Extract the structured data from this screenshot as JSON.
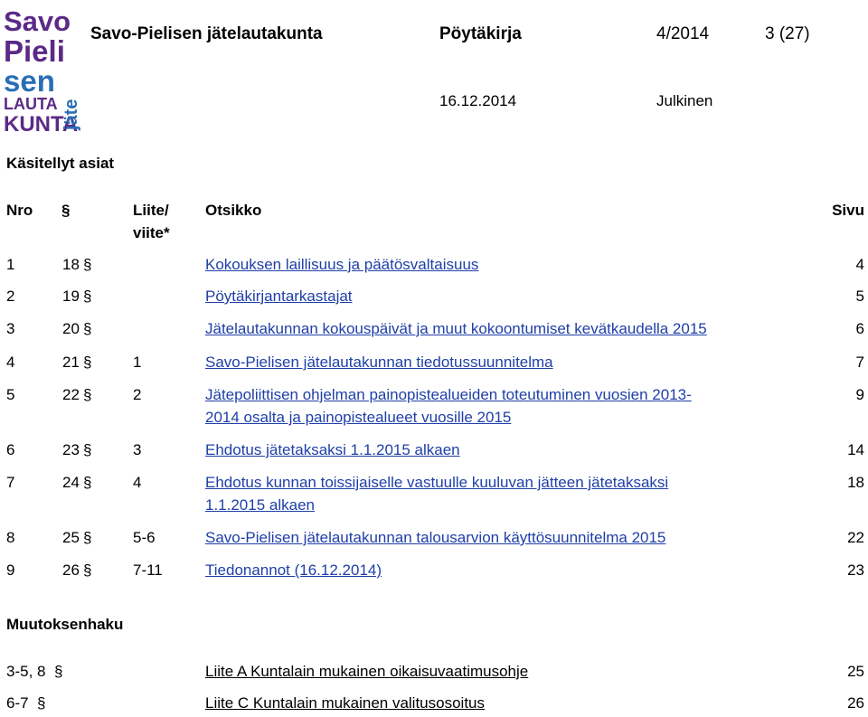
{
  "logo": {
    "lines": [
      "Savo",
      "Pieli",
      "sen",
      "LAUTA",
      "KUNTA"
    ],
    "side": "jäte",
    "colors": {
      "purple": "#5b2a86",
      "blue": "#2a6fb5"
    }
  },
  "header": {
    "org": "Savo-Pielisen jätelautakunta",
    "doc_type": "Pöytäkirja",
    "doc_no": "4/2014",
    "page": "3 (27)",
    "date": "16.12.2014",
    "status": "Julkinen"
  },
  "section1": "Käsitellyt asiat",
  "columns": {
    "nro": "Nro",
    "par_sign": "§",
    "liite": "Liite/\nviite*",
    "otsikko": "Otsikko",
    "sivu": "Sivu"
  },
  "items": [
    {
      "nro": "1",
      "par": "18",
      "liite": "",
      "title_lines": [
        "Kokouksen laillisuus ja päätösvaltaisuus"
      ],
      "sivu": "4"
    },
    {
      "nro": "2",
      "par": "19",
      "liite": "",
      "title_lines": [
        "Pöytäkirjantarkastajat"
      ],
      "sivu": "5"
    },
    {
      "nro": "3",
      "par": "20",
      "liite": "",
      "title_lines": [
        "Jätelautakunnan kokouspäivät ja muut kokoontumiset kevätkaudella 2015"
      ],
      "sivu": "6"
    },
    {
      "nro": "4",
      "par": "21",
      "liite": "1",
      "title_lines": [
        "Savo-Pielisen jätelautakunnan tiedotussuunnitelma"
      ],
      "sivu": "7"
    },
    {
      "nro": "5",
      "par": "22",
      "liite": "2",
      "title_lines": [
        "Jätepoliittisen ohjelman painopistealueiden toteutuminen vuosien 2013-",
        "2014 osalta ja painopistealueet vuosille 2015"
      ],
      "sivu": "9"
    },
    {
      "nro": "6",
      "par": "23",
      "liite": "3",
      "title_lines": [
        "Ehdotus jätetaksaksi 1.1.2015 alkaen"
      ],
      "sivu": "14"
    },
    {
      "nro": "7",
      "par": "24",
      "liite": "4",
      "title_lines": [
        "Ehdotus kunnan toissijaiselle vastuulle kuuluvan jätteen jätetaksaksi",
        "1.1.2015 alkaen"
      ],
      "sivu": "18"
    },
    {
      "nro": "8",
      "par": "25",
      "liite": "5-6",
      "title_lines": [
        "Savo-Pielisen jätelautakunnan talousarvion käyttösuunnitelma 2015"
      ],
      "sivu": "22"
    },
    {
      "nro": "9",
      "par": "26",
      "liite": "7-11",
      "title_lines": [
        "Tiedonannot (16.12.2014)"
      ],
      "sivu": "23"
    }
  ],
  "section2": "Muutoksenhaku",
  "appeals": [
    {
      "ref": "3-5, 8",
      "title": "Liite A Kuntalain mukainen oikaisuvaatimusohje",
      "sivu": "25"
    },
    {
      "ref": "6-7",
      "title": "Liite C Kuntalain mukainen valitusosoitus",
      "sivu": "26"
    }
  ]
}
